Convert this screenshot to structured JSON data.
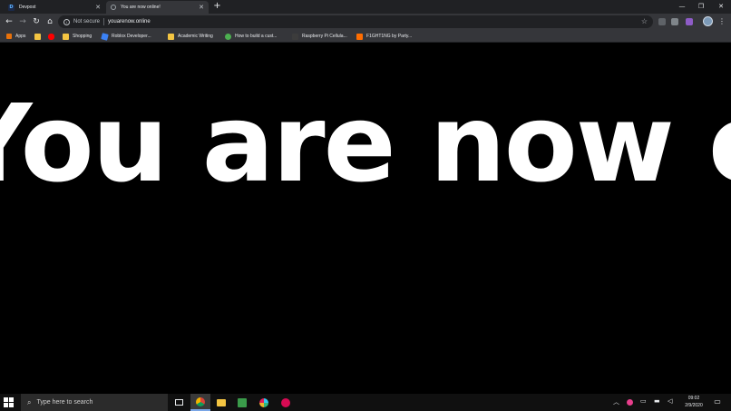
{
  "tabs": [
    {
      "favicon": "D",
      "title": "Devpost",
      "close": "✕"
    },
    {
      "title": "You are now online!",
      "close": "✕"
    }
  ],
  "new_tab": "+",
  "window_controls": {
    "minimize": "—",
    "restore": "❐",
    "close": "✕"
  },
  "toolbar": {
    "back": "←",
    "forward": "→",
    "reload": "↻",
    "home": "⌂",
    "security_icon": "i",
    "security_label": "Not secure",
    "url": "youarenow.online",
    "star": "☆",
    "menu": "⋮"
  },
  "bookmarks": [
    {
      "label": "Apps",
      "icon": "apps-grid-icon",
      "color": "#e8710a"
    },
    {
      "label": "",
      "icon": "folder-icon",
      "color": "#f4c542"
    },
    {
      "label": "",
      "icon": "youtube-icon",
      "color": "#ff0000"
    },
    {
      "label": "Shopping",
      "icon": "folder-icon",
      "color": "#f4c542"
    },
    {
      "label": "Roblox Developer...",
      "icon": "roblox-icon",
      "color": "#3b82f6"
    },
    {
      "label": "Academic Writing",
      "icon": "folder-icon",
      "color": "#f4c542"
    },
    {
      "label": "How to build a cust...",
      "icon": "site-icon",
      "color": "#4caf50"
    },
    {
      "label": "Raspberry Pi Cellula...",
      "icon": "raspberry-icon",
      "color": "#3c3c3c"
    },
    {
      "label": "F1GHT1NG by Party...",
      "icon": "site-icon",
      "color": "#ff6d00"
    }
  ],
  "page": {
    "headline": "You are now online"
  },
  "taskbar": {
    "search_placeholder": "Type here to search",
    "time": "09:02",
    "date": "2/9/2020"
  },
  "colors": {
    "tabstrip": "#202124",
    "toolbar": "#35363a",
    "page_bg": "#000000",
    "page_text": "#ffffff",
    "taskbar": "#101010"
  }
}
